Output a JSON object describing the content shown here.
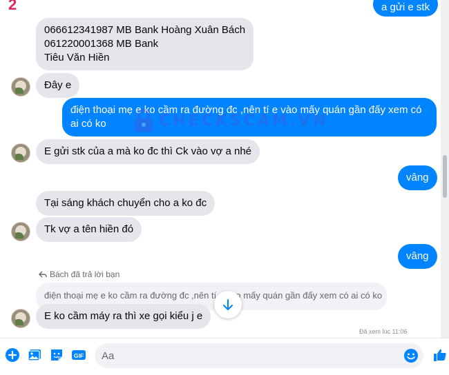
{
  "header_mark": "2",
  "messages": {
    "account_lines": [
      "066612341987 MB Bank Hoàng Xuân Bách",
      "061220001368 MB Bank",
      "Tiêu Văn Hiền"
    ],
    "m_day_e": "Đây e",
    "m_dien_thoai_line1": "điện thoại mẹ e ko cầm ra đường đc ,nên tí e vào mấy quán gần đấy xem có",
    "m_dien_thoai_line2": "ai có ko",
    "m_gui_stk": "E gửi stk của a mà ko đc thì Ck vào vợ a nhé",
    "m_vang_1": "vâng",
    "m_tai_sang": "Tại sáng khách chuyển cho a ko đc",
    "m_tk_vo": "Tk vợ a tên hiền đó",
    "m_vang_2": "vâng",
    "m_top_partial": "a gửi e stk",
    "m_ko_cam": "E ko cầm máy ra thì xe gọi kiểu j e"
  },
  "reply": {
    "note": "Bách đã trả lời bạn",
    "quoted": "điện thoại mẹ e ko cầm ra đường đc ,nên tí e vào mấy quán gần đấy xem có ai có ko"
  },
  "watermark": "CHECKSCAM.VN",
  "seen_text": "Đã xem lúc 11:06",
  "composer": {
    "placeholder": "Aa"
  },
  "icons": [
    "plus-icon",
    "photo-icon",
    "sticker-icon",
    "gif-icon",
    "emoji-icon",
    "like-icon",
    "arrow-down-icon",
    "reply-arrow-icon"
  ],
  "colors": {
    "accent": "#0084ff",
    "incoming_bubble": "#e4e6eb",
    "watermark": "#6d3fc7",
    "mark": "#e0245e"
  }
}
